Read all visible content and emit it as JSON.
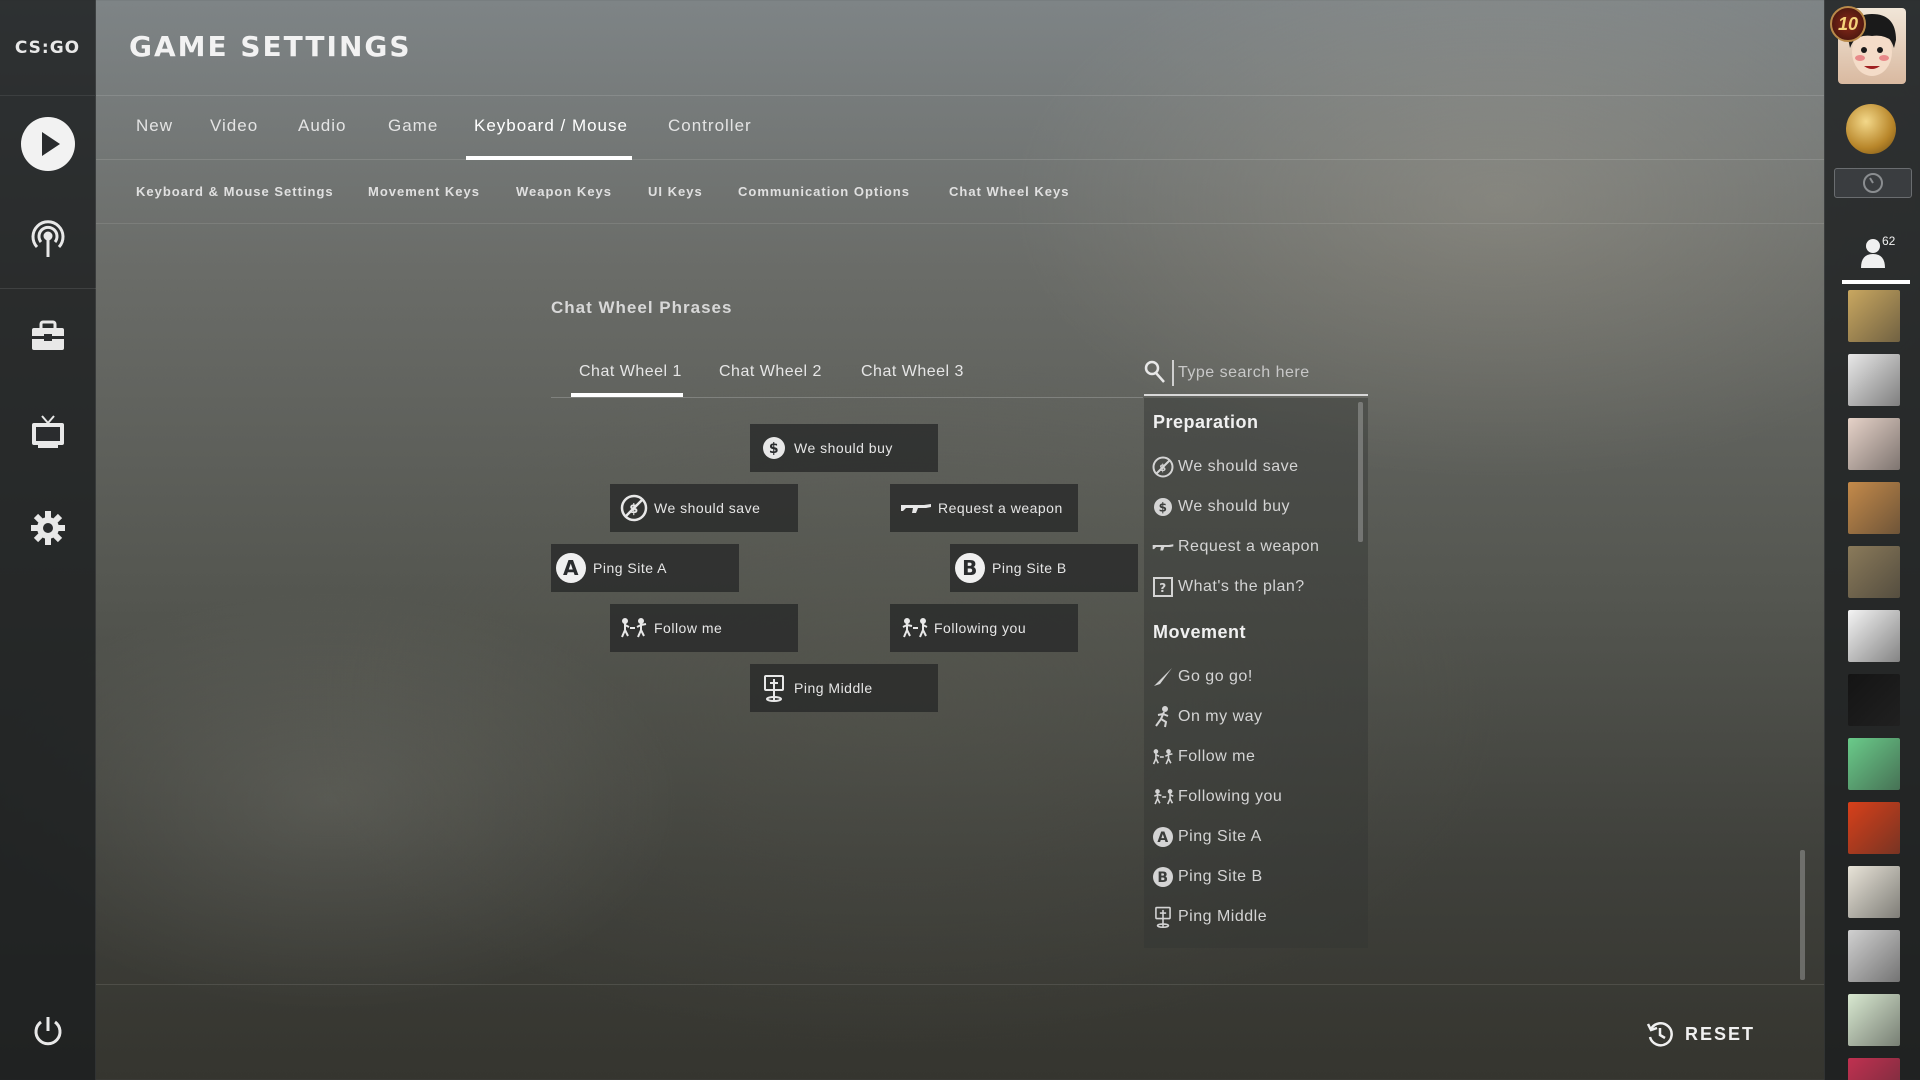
{
  "app": {
    "logo_text": "CS:GO",
    "page_title": "GAME SETTINGS"
  },
  "main_tabs": [
    {
      "label": "New"
    },
    {
      "label": "Video"
    },
    {
      "label": "Audio"
    },
    {
      "label": "Game"
    },
    {
      "label": "Keyboard / Mouse",
      "active": true
    },
    {
      "label": "Controller"
    }
  ],
  "sub_tabs": [
    {
      "label": "Keyboard & Mouse Settings"
    },
    {
      "label": "Movement Keys"
    },
    {
      "label": "Weapon Keys"
    },
    {
      "label": "UI Keys"
    },
    {
      "label": "Communication Options"
    },
    {
      "label": "Chat Wheel Keys"
    }
  ],
  "left_nav": [
    {
      "icon": "play-icon"
    },
    {
      "icon": "broadcast-icon"
    },
    {
      "icon": "inventory-icon"
    },
    {
      "icon": "tv-icon"
    },
    {
      "icon": "gear-icon"
    },
    {
      "icon": "power-icon"
    }
  ],
  "chat_wheel": {
    "title": "Chat Wheel Phrases",
    "tabs": [
      {
        "label": "Chat Wheel 1",
        "active": true
      },
      {
        "label": "Chat Wheel 2"
      },
      {
        "label": "Chat Wheel 3"
      }
    ],
    "slots": [
      {
        "label": "We should buy",
        "icon": "dollar-icon"
      },
      {
        "label": "We should save",
        "icon": "no-dollar-icon"
      },
      {
        "label": "Request a weapon",
        "icon": "rifle-icon"
      },
      {
        "label": "Ping Site A",
        "icon": "site-a-icon"
      },
      {
        "label": "Ping Site B",
        "icon": "site-b-icon"
      },
      {
        "label": "Follow me",
        "icon": "follow-me-icon"
      },
      {
        "label": "Following you",
        "icon": "following-you-icon"
      },
      {
        "label": "Ping Middle",
        "icon": "ping-middle-icon"
      }
    ]
  },
  "search": {
    "placeholder": "Type search here",
    "value": ""
  },
  "phrase_list": {
    "groups": [
      {
        "heading": "Preparation",
        "items": [
          {
            "label": "We should save",
            "icon": "no-dollar-icon"
          },
          {
            "label": "We should buy",
            "icon": "dollar-icon"
          },
          {
            "label": "Request a weapon",
            "icon": "rifle-icon"
          },
          {
            "label": "What's the plan?",
            "icon": "question-box-icon"
          }
        ]
      },
      {
        "heading": "Movement",
        "items": [
          {
            "label": "Go go go!",
            "icon": "knife-icon"
          },
          {
            "label": "On my way",
            "icon": "running-icon"
          },
          {
            "label": "Follow me",
            "icon": "follow-me-icon"
          },
          {
            "label": "Following you",
            "icon": "following-you-icon"
          },
          {
            "label": "Ping Site A",
            "icon": "site-a-icon"
          },
          {
            "label": "Ping Site B",
            "icon": "site-b-icon"
          },
          {
            "label": "Ping Middle",
            "icon": "ping-middle-icon"
          }
        ]
      }
    ]
  },
  "bottom": {
    "reset_label": "RESET"
  },
  "right_bar": {
    "rank_number": "10",
    "friends_count": "62",
    "friend_colors": [
      "#c9a760",
      "#e8e8e8",
      "#e6d2c8",
      "#c48a4a",
      "#8a7a5a",
      "#f4f4f4",
      "#141414",
      "#6acb8a",
      "#d8401a",
      "#e8e4d8",
      "#d0d0d0",
      "#d8e8d0",
      "#c03050"
    ]
  },
  "colors": {
    "text": "#e6e6e6",
    "panel": "#262828",
    "accent": "#ffffff"
  }
}
